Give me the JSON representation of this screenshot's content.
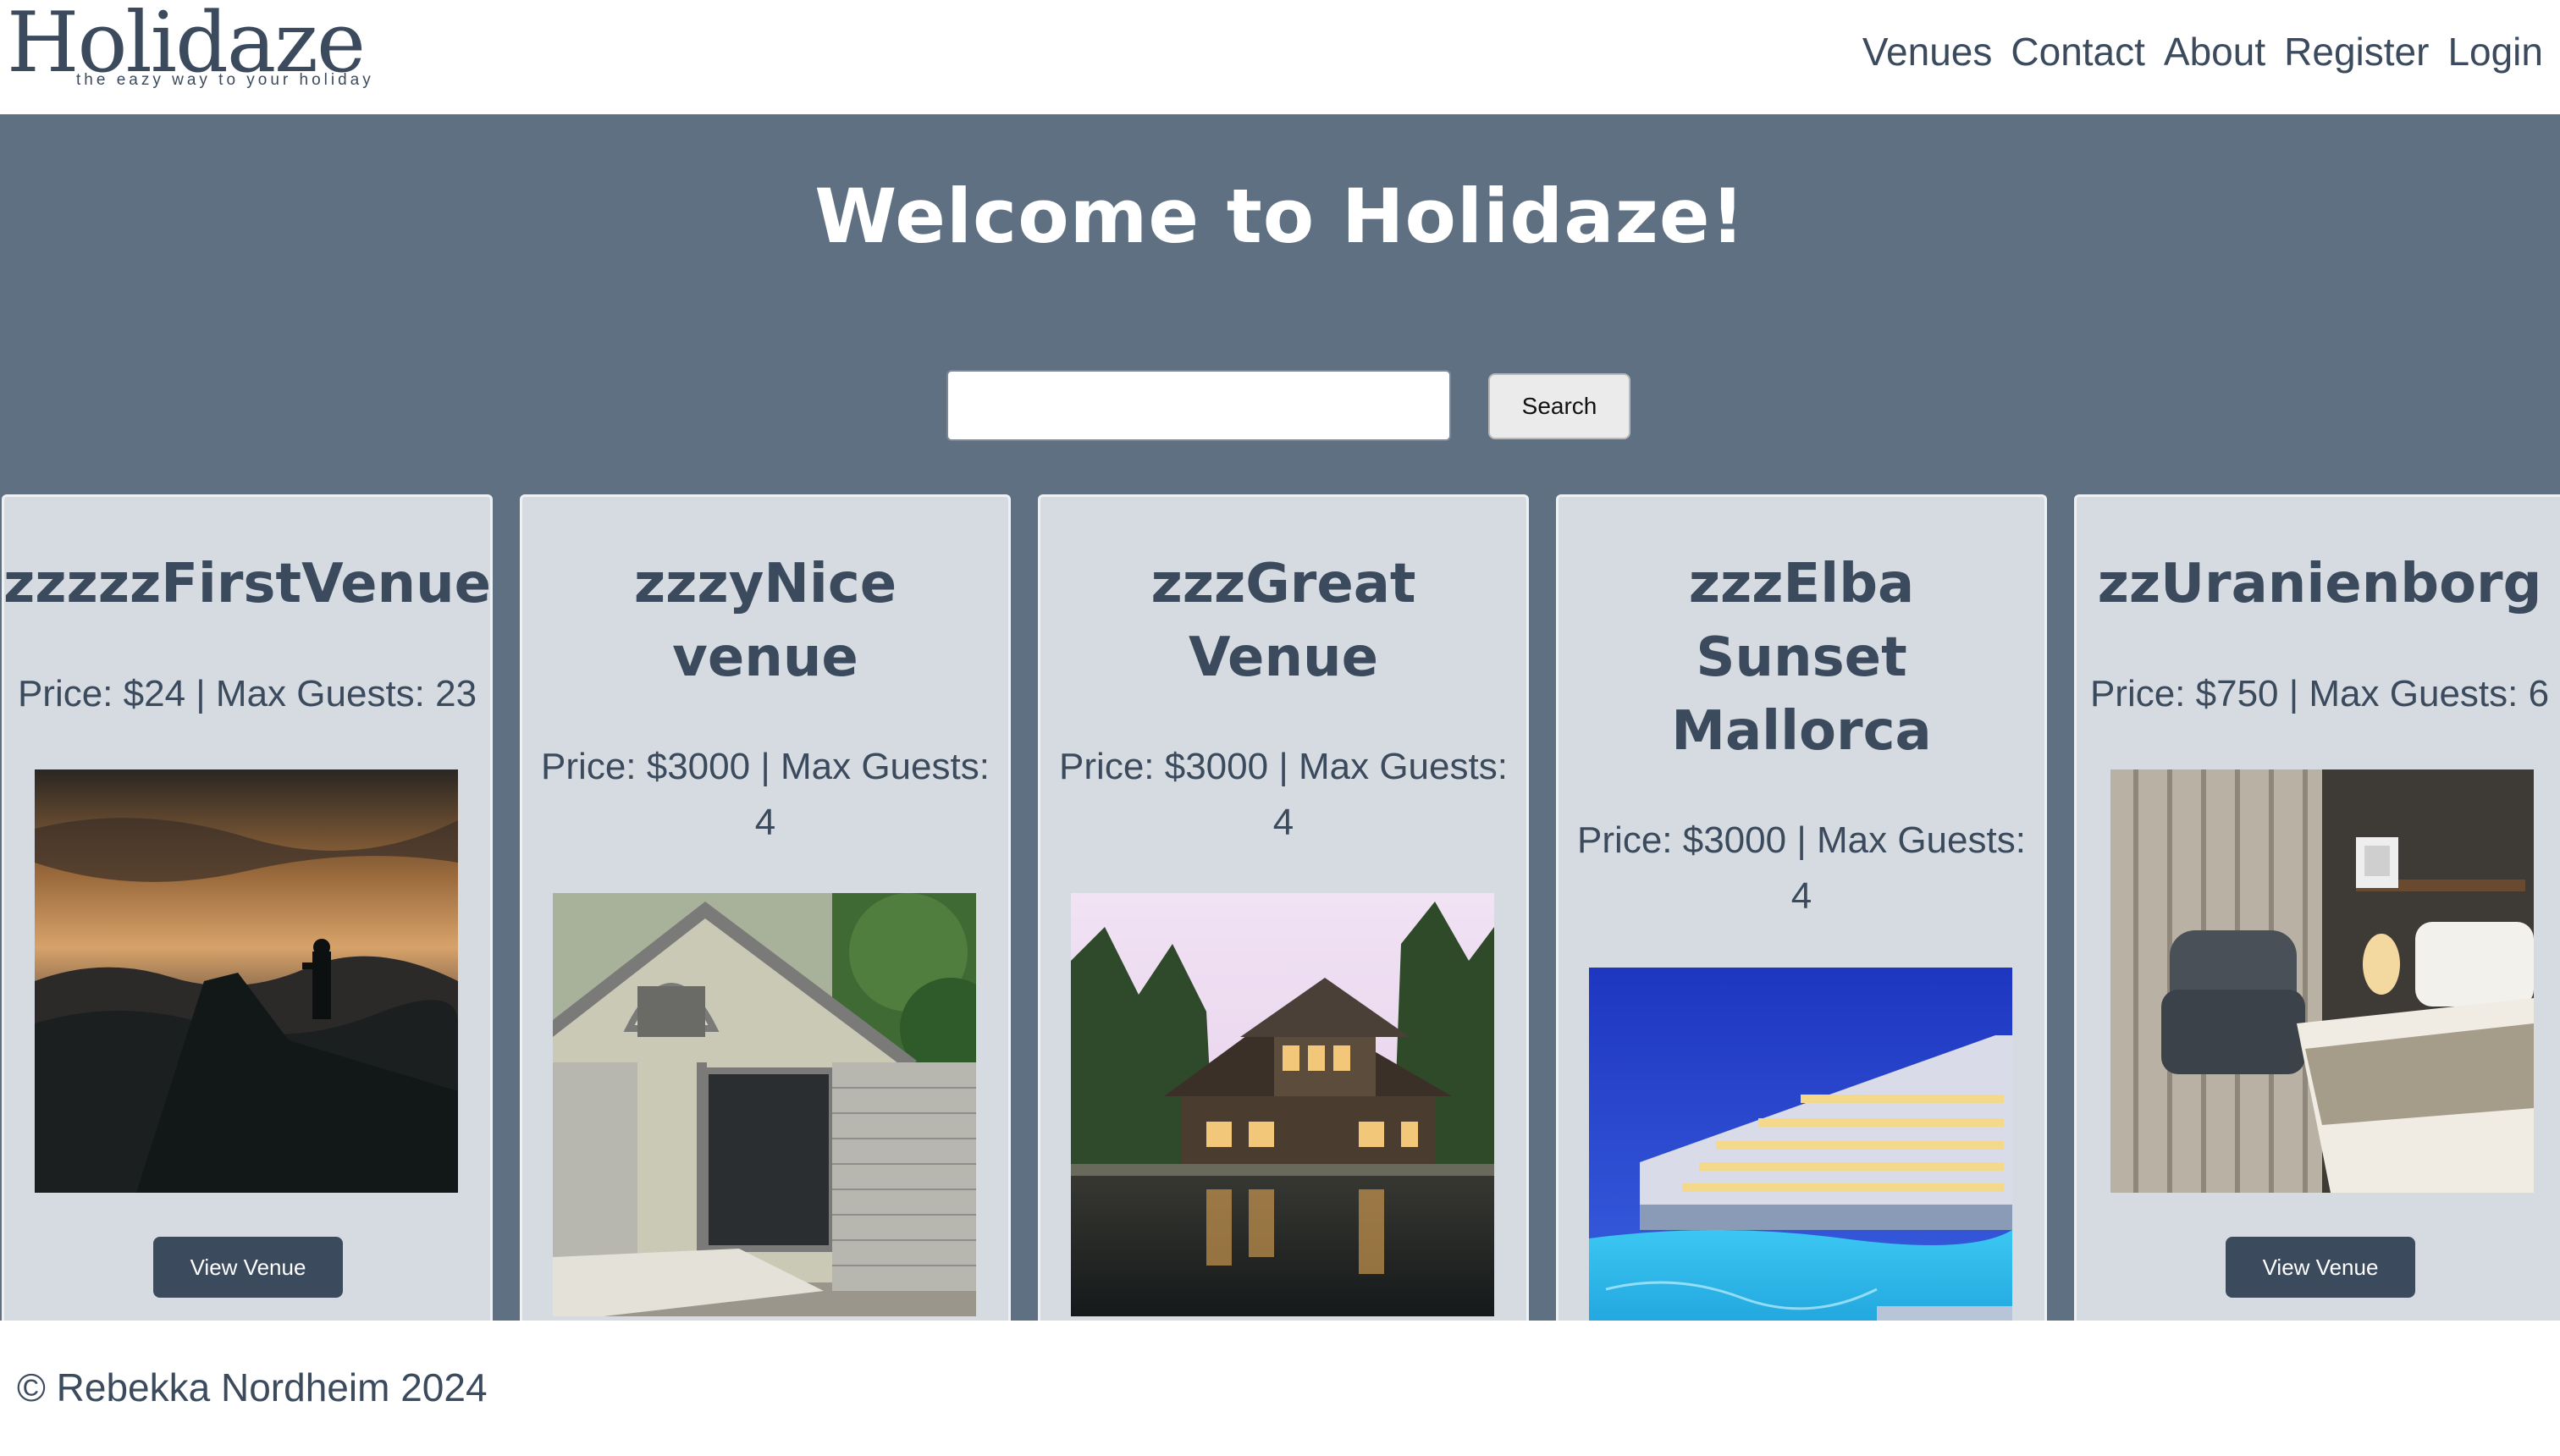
{
  "brand": {
    "name": "Holidaze",
    "tagline": "the eazy way to your holiday"
  },
  "nav": [
    "Venues",
    "Contact",
    "About",
    "Register",
    "Login"
  ],
  "hero": {
    "title": "Welcome to Holidaze!",
    "search_value": "",
    "search_button": "Search"
  },
  "venues": [
    {
      "name": "zzzzzFirstVenue",
      "meta": "Price: $24 | Max Guests: 23",
      "button": "View Venue",
      "image": "sunset-silhouette-mountain-photo"
    },
    {
      "name_lines": [
        "zzzyNice",
        "venue"
      ],
      "meta_lines": [
        "Price: $3000 | Max Guests:",
        "4"
      ],
      "image": "small-cabin-house-photo"
    },
    {
      "name_lines": [
        "zzzGreat",
        "Venue"
      ],
      "meta_lines": [
        "Price: $3000 | Max Guests:",
        "4"
      ],
      "image": "lake-house-evening-photo"
    },
    {
      "name_lines": [
        "zzzElba",
        "Sunset",
        "Mallorca"
      ],
      "meta_lines": [
        "Price: $3000 | Max Guests:",
        "4"
      ],
      "image": "resort-pool-night-photo"
    },
    {
      "name": "zzUranienborg",
      "meta": "Price: $750 | Max Guests: 6",
      "button": "View Venue",
      "image": "hotel-bedroom-photo"
    }
  ],
  "footer": {
    "copyright": "© Rebekka Nordheim 2024"
  }
}
